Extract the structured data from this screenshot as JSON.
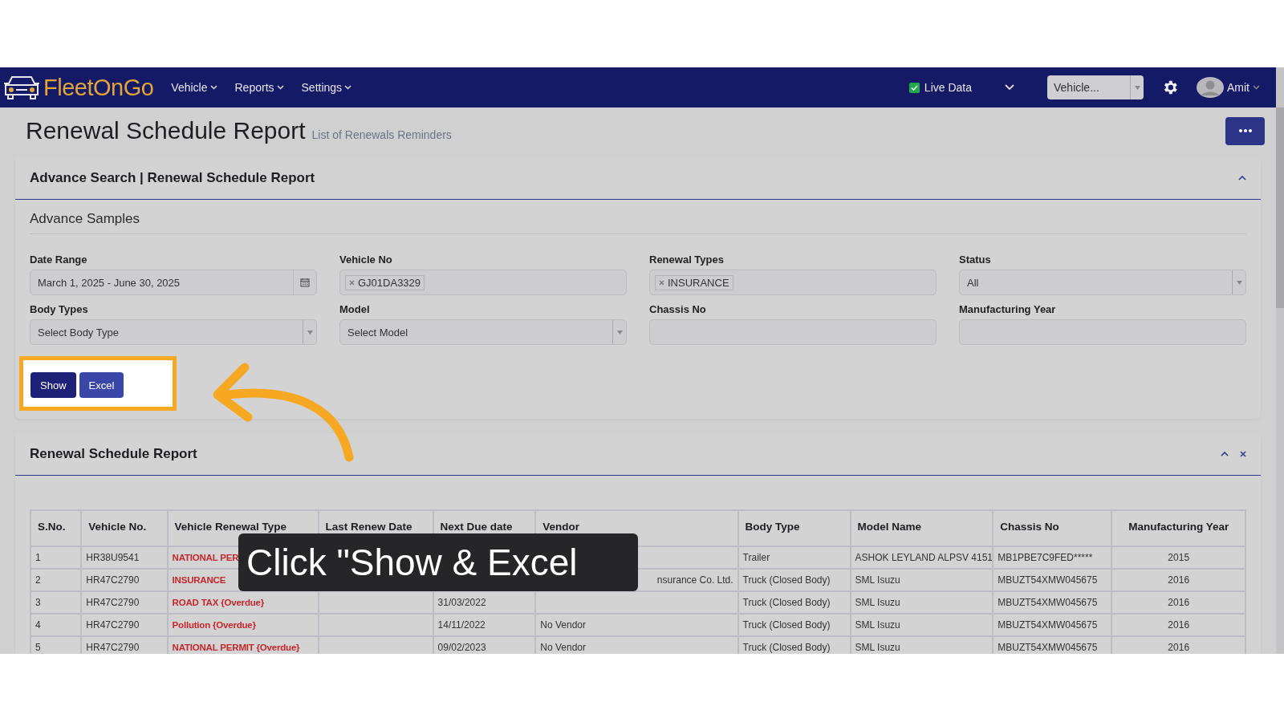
{
  "nav": {
    "brand": "FleetOnGo",
    "menus": [
      "Vehicle",
      "Reports",
      "Settings"
    ],
    "live_data": {
      "label": "Live Data",
      "checked": true
    },
    "vehicle_select": {
      "placeholder": "Vehicle..."
    },
    "user": "Amit"
  },
  "page": {
    "title": "Renewal Schedule Report",
    "subtitle": "List of Renewals Reminders"
  },
  "search_card": {
    "title": "Advance Search | Renewal Schedule Report",
    "section": "Advance Samples",
    "fields": [
      {
        "kind": "date",
        "label": "Date Range",
        "value": "March 1, 2025 - June 30, 2025"
      },
      {
        "kind": "tags",
        "label": "Vehicle No",
        "tags": [
          "GJ01DA3329"
        ]
      },
      {
        "kind": "tags",
        "label": "Renewal Types",
        "tags": [
          "INSURANCE"
        ]
      },
      {
        "kind": "select",
        "label": "Status",
        "value": "All"
      },
      {
        "kind": "select",
        "label": "Body Types",
        "value": "Select Body Type"
      },
      {
        "kind": "select",
        "label": "Model",
        "value": "Select Model"
      },
      {
        "kind": "text",
        "label": "Chassis No"
      },
      {
        "kind": "text",
        "label": "Manufacturing Year"
      }
    ],
    "buttons": [
      {
        "label": "Show",
        "kind": "primary"
      },
      {
        "label": "Excel",
        "kind": "secondary"
      }
    ]
  },
  "report_card": {
    "title": "Renewal Schedule Report",
    "columns": [
      {
        "label": "S.No."
      },
      {
        "label": "Vehicle No."
      },
      {
        "label": "Vehicle Renewal Type",
        "alert": true
      },
      {
        "label": "Last Renew Date"
      },
      {
        "label": "Next Due date"
      },
      {
        "label": "Vendor"
      },
      {
        "label": "Body Type"
      },
      {
        "label": "Model Name"
      },
      {
        "label": "Chassis No"
      },
      {
        "label": "Manufacturing Year",
        "centered": true
      }
    ],
    "rows": [
      [
        "1",
        "HR38U9541",
        "NATIONAL PER",
        "",
        "",
        "",
        "Trailer",
        "ASHOK LEYLAND ALPSV 4151",
        "MB1PBE7C9FED*****",
        "2015"
      ],
      [
        "2",
        "HR47C2790",
        "INSURANCE",
        "",
        "",
        {
          "text": "nsurance Co. Ltd.",
          "covered_left": true
        },
        "Truck (Closed Body)",
        "SML Isuzu",
        "MBUZT54XMW045675",
        "2016"
      ],
      [
        "3",
        "HR47C2790",
        "ROAD TAX {Overdue}",
        "",
        "31/03/2022",
        "",
        "Truck (Closed Body)",
        "SML Isuzu",
        "MBUZT54XMW045675",
        "2016"
      ],
      [
        "4",
        "HR47C2790",
        "Pollution {Overdue}",
        "",
        "14/11/2022",
        "No Vendor",
        "Truck (Closed Body)",
        "SML Isuzu",
        "MBUZT54XMW045675",
        "2016"
      ],
      [
        "5",
        "HR47C2790",
        "NATIONAL PERMIT {Overdue}",
        "",
        "09/02/2023",
        "No Vendor",
        "Truck (Closed Body)",
        "SML Isuzu",
        "MBUZT54XMW045675",
        "2016"
      ]
    ]
  },
  "tutorial": {
    "caption": "Click \"Show & Excel"
  }
}
